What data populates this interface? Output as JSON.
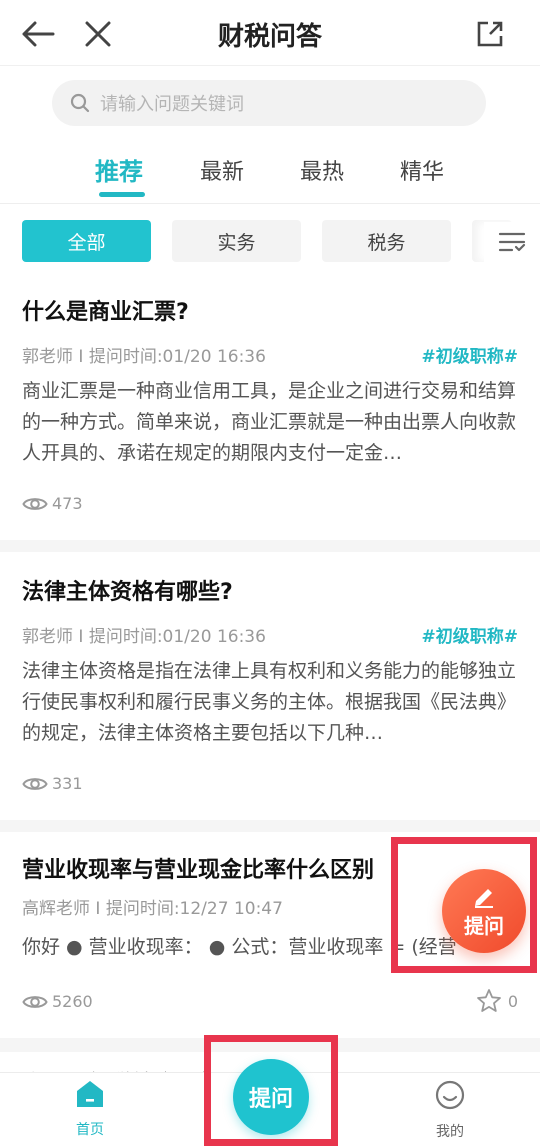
{
  "header": {
    "title": "财税问答"
  },
  "search": {
    "placeholder": "请输入问题关键词"
  },
  "tabs": [
    {
      "label": "推荐",
      "active": true
    },
    {
      "label": "最新",
      "active": false
    },
    {
      "label": "最热",
      "active": false
    },
    {
      "label": "精华",
      "active": false
    }
  ],
  "chips": [
    {
      "label": "全部",
      "active": true
    },
    {
      "label": "实务",
      "active": false
    },
    {
      "label": "税务",
      "active": false
    }
  ],
  "questions": [
    {
      "title": "什么是商业汇票?",
      "meta": "郭老师 I 提问时间:01/20 16:36",
      "tag": "#初级职称#",
      "body": "商业汇票是一种商业信用工具，是企业之间进行交易和结算的一种方式。简单来说，商业汇票就是一种由出票人向收款人开具的、承诺在规定的期限内支付一定金…",
      "views": "473"
    },
    {
      "title": "法律主体资格有哪些?",
      "meta": "郭老师 I 提问时间:01/20 16:36",
      "tag": "#初级职称#",
      "body": "法律主体资格是指在法律上具有权利和义务能力的能够独立行使民事权利和履行民事义务的主体。根据我国《民法典》的规定，法律主体资格主要包括以下几种…",
      "views": "331"
    },
    {
      "title": "营业收现率与营业现金比率什么区别",
      "meta": "高辉老师 I 提问时间:12/27 10:47",
      "tag": "",
      "body": "你好 ● 营业收现率： ● 公式：营业收现率 = (经营",
      "views": "5260",
      "stars": "0"
    }
  ],
  "peek_title": "个人所得税综合所得",
  "float_ask": {
    "label": "提问"
  },
  "bottom_nav": {
    "home": "首页",
    "ask": "提问",
    "mine": "我的"
  },
  "colors": {
    "accent": "#22b8c4",
    "ask_orange": "#f05a35",
    "highlight": "#e8354d"
  }
}
